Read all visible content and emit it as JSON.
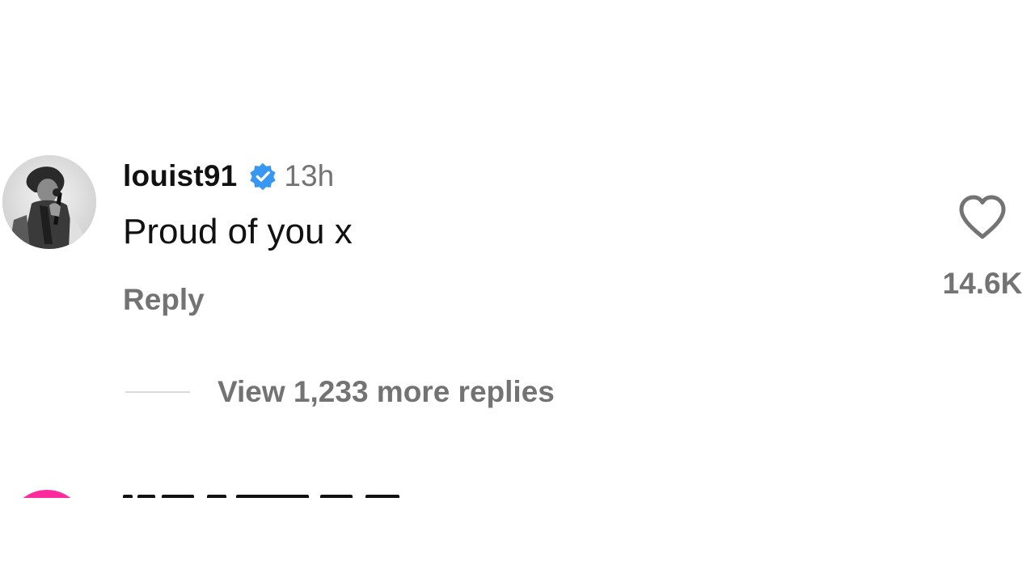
{
  "comment": {
    "username": "louist91",
    "verified_icon": "verified-badge-icon",
    "verified_color": "#3897f0",
    "timestamp": "13h",
    "text": "Proud of you x",
    "reply_label": "Reply",
    "like_icon": "heart-outline-icon",
    "like_count": "14.6K",
    "view_replies_label": "View 1,233 more replies"
  },
  "next_comment": {
    "avatar_color": "#ff2b9d"
  },
  "colors": {
    "primary_text": "#111111",
    "secondary_text": "#737373",
    "divider": "#dbdbdb",
    "background": "#ffffff"
  }
}
